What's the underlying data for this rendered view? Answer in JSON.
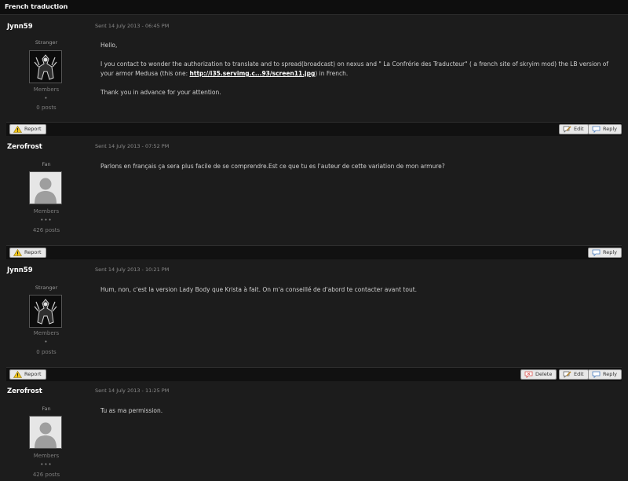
{
  "topic": {
    "title": "French traduction"
  },
  "posts": [
    {
      "author": "Jynn59",
      "date": "Sent 14 July 2013 - 06:45 PM",
      "rank": "Stranger",
      "group": "Members",
      "pips": "•",
      "post_count": "0 posts",
      "avatar": "dark-armor-avatar",
      "paragraphs": [
        "Hello,",
        "I you contact to wonder the authorization to translate and to spread(broadcast) on nexus and \" La Confrérie des Traducteur\" ( a french site of skryim mod) the LB version of your armor Medusa (this one: ",
        "Thank you in advance for your attention."
      ],
      "link_text": "http://i35.servimg.c...93/screen11.jpg",
      "link_after": ") in French.",
      "actions_left": [
        "Report"
      ],
      "actions_right": [
        "Edit",
        "Reply"
      ]
    },
    {
      "author": "Zerofrost",
      "date": "Sent 14 July 2013 - 07:52 PM",
      "rank": "Fan",
      "group": "Members",
      "pips": "•••",
      "post_count": "426 posts",
      "avatar": "default-user-avatar",
      "text": "Parlons en français ça sera plus facile de se comprendre.Est ce que tu es l'auteur de cette variation de mon armure?",
      "actions_left": [
        "Report"
      ],
      "actions_right": [
        "Reply"
      ]
    },
    {
      "author": "Jynn59",
      "date": "Sent 14 July 2013 - 10:21 PM",
      "rank": "Stranger",
      "group": "Members",
      "pips": "•",
      "post_count": "0 posts",
      "avatar": "dark-armor-avatar",
      "text": "Hum, non, c'est la version Lady Body que Krista à fait. On m'a conseillé de d'abord te contacter avant tout.",
      "actions_left": [
        "Report"
      ],
      "actions_right": [
        "Delete",
        "Edit",
        "Reply"
      ]
    },
    {
      "author": "Zerofrost",
      "date": "Sent 14 July 2013 - 11:25 PM",
      "rank": "Fan",
      "group": "Members",
      "pips": "•••",
      "post_count": "426 posts",
      "avatar": "default-user-avatar",
      "text": "Tu as ma permission."
    }
  ],
  "icons": {
    "report": "warning-icon",
    "edit": "edit-icon",
    "reply": "reply-icon",
    "delete": "delete-icon"
  },
  "colors": {
    "background": "#1c1c1c",
    "title_bar": "#0e0e0e",
    "action_bar": "#111111",
    "button": "#e8e8e8",
    "warning": "#f0c419",
    "delete": "#d9534f"
  }
}
